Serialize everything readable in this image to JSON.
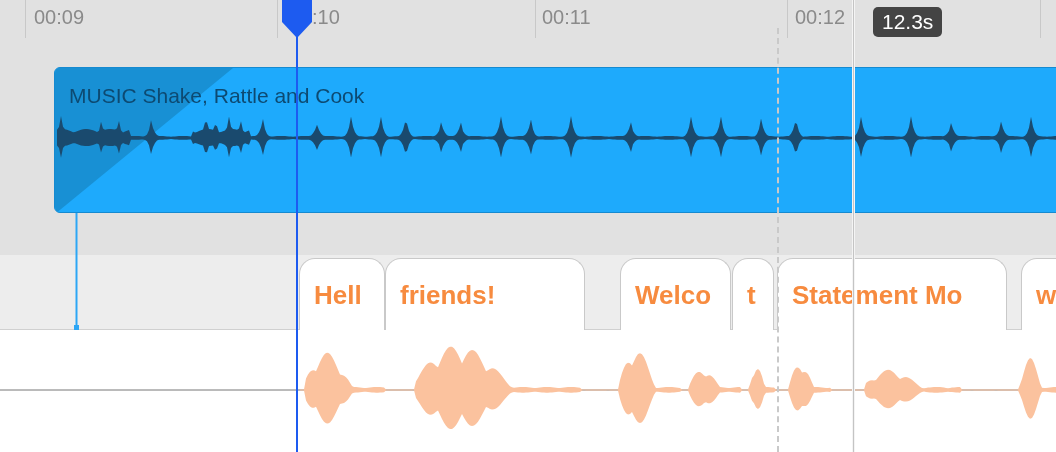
{
  "ruler": {
    "labels": [
      {
        "text": "00:09"
      },
      {
        "text": ":10"
      },
      {
        "text": "00:11"
      },
      {
        "text": "00:12"
      }
    ]
  },
  "tooltip": {
    "text": "12.3s"
  },
  "clip": {
    "label": "MUSIC Shake, Rattle and Cook"
  },
  "words": [
    {
      "text": "Hell"
    },
    {
      "text": "friends!"
    },
    {
      "text": "Welco"
    },
    {
      "text": "t"
    },
    {
      "text": "Statement Mo"
    },
    {
      "text": "w"
    }
  ]
}
